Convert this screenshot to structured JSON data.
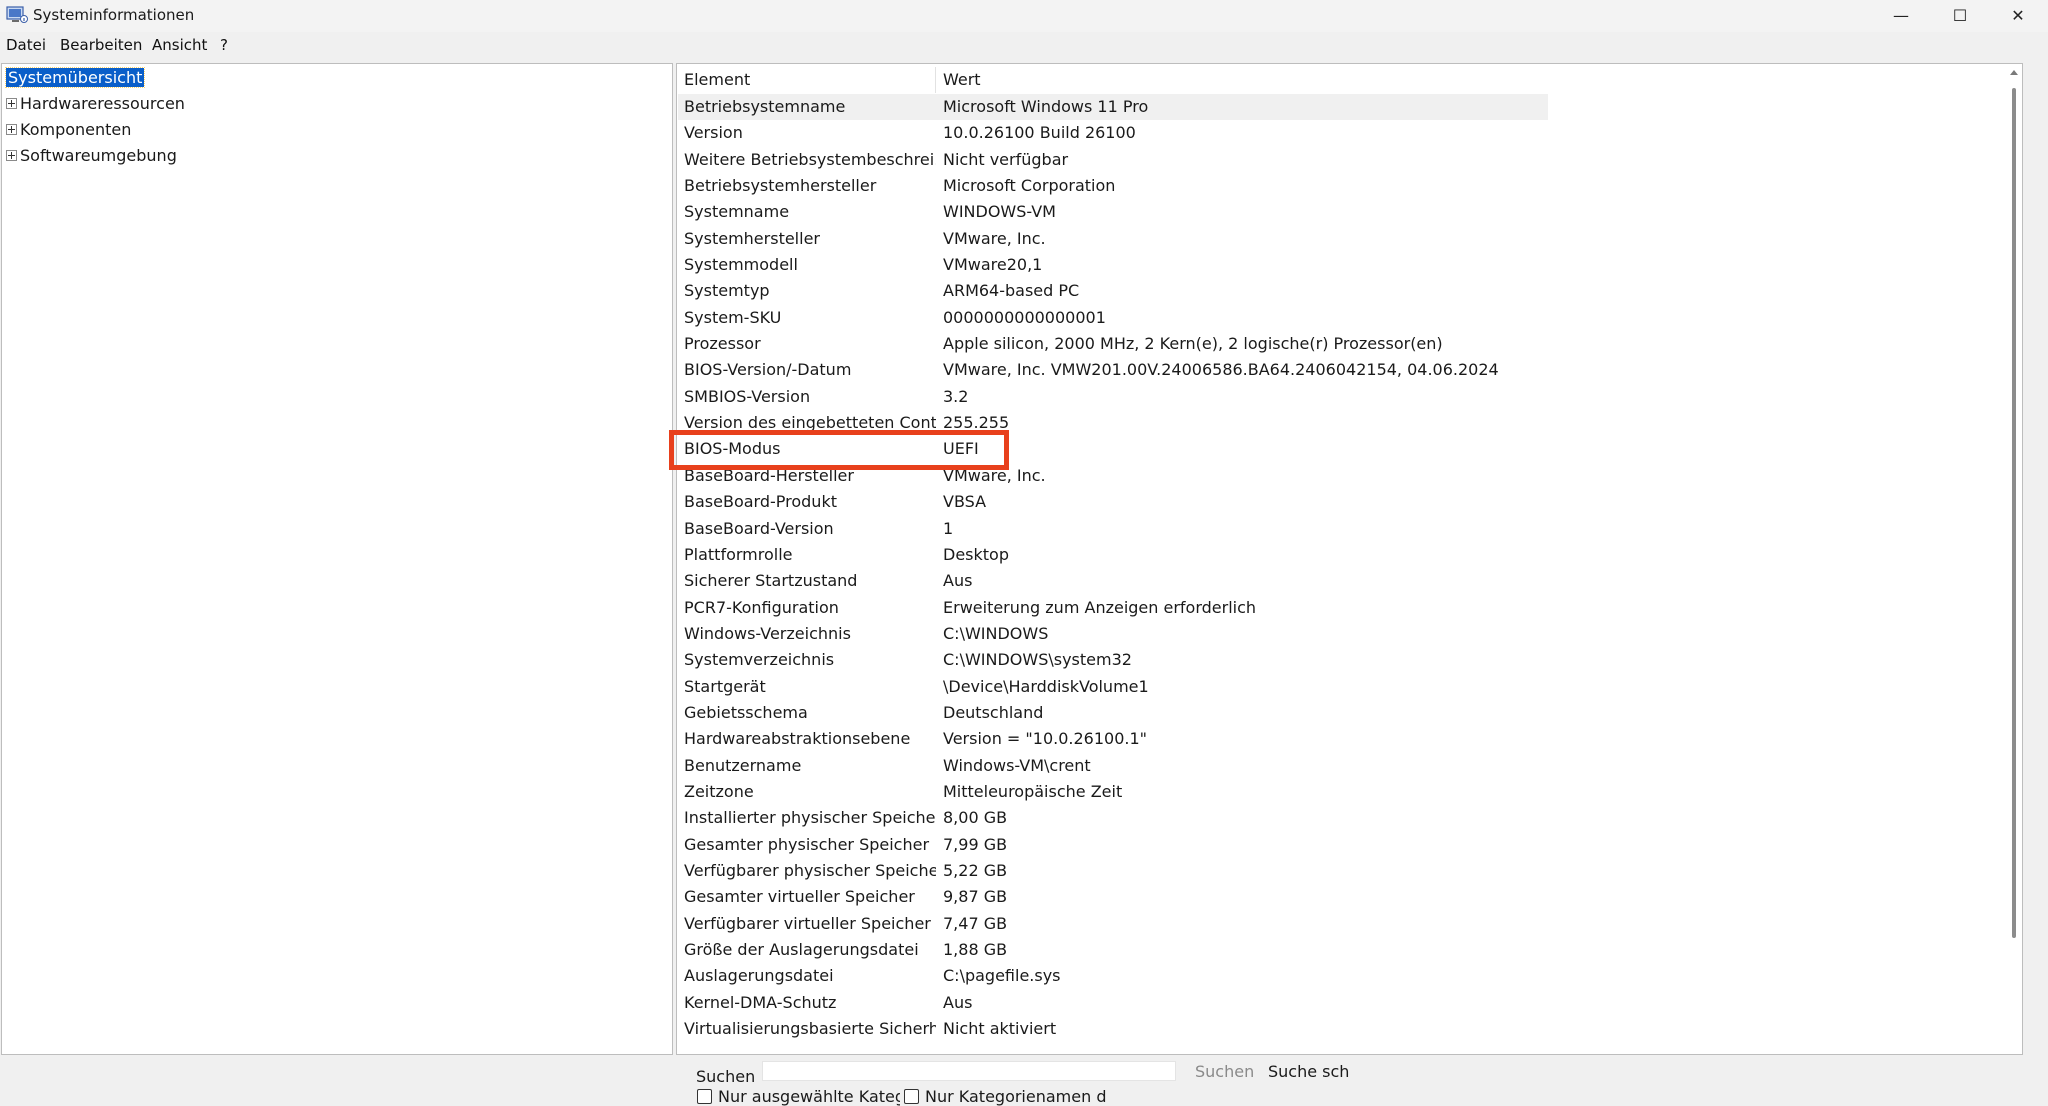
{
  "window": {
    "title": "Systeminformationen",
    "minimize_glyph": "—",
    "maximize_glyph": "☐",
    "close_glyph": "✕"
  },
  "menu": [
    "Datei",
    "Bearbeiten",
    "Ansicht",
    "?"
  ],
  "tree": {
    "items": [
      {
        "label": "Systemübersicht",
        "selected": true,
        "expandable": false
      },
      {
        "label": "Hardwareressourcen",
        "selected": false,
        "expandable": true
      },
      {
        "label": "Komponenten",
        "selected": false,
        "expandable": true
      },
      {
        "label": "Softwareumgebung",
        "selected": false,
        "expandable": true
      }
    ]
  },
  "list": {
    "columns": [
      "Element",
      "Wert"
    ],
    "rows": [
      [
        "Betriebsystemname",
        "Microsoft Windows 11 Pro"
      ],
      [
        "Version",
        "10.0.26100 Build 26100"
      ],
      [
        "Weitere Betriebsystembeschrei...",
        "Nicht verfügbar"
      ],
      [
        "Betriebsystemhersteller",
        "Microsoft Corporation"
      ],
      [
        "Systemname",
        "WINDOWS-VM"
      ],
      [
        "Systemhersteller",
        "VMware, Inc."
      ],
      [
        "Systemmodell",
        "VMware20,1"
      ],
      [
        "Systemtyp",
        "ARM64-based PC"
      ],
      [
        "System-SKU",
        "0000000000000001"
      ],
      [
        "Prozessor",
        "Apple silicon, 2000 MHz, 2 Kern(e), 2 logische(r) Prozessor(en)"
      ],
      [
        "BIOS-Version/-Datum",
        "VMware, Inc. VMW201.00V.24006586.BA64.2406042154, 04.06.2024"
      ],
      [
        "SMBIOS-Version",
        "3.2"
      ],
      [
        "Version des eingebetteten Cont...",
        "255.255"
      ],
      [
        "BIOS-Modus",
        "UEFI"
      ],
      [
        "BaseBoard-Hersteller",
        "VMware, Inc."
      ],
      [
        "BaseBoard-Produkt",
        "VBSA"
      ],
      [
        "BaseBoard-Version",
        "1"
      ],
      [
        "Plattformrolle",
        "Desktop"
      ],
      [
        "Sicherer Startzustand",
        "Aus"
      ],
      [
        "PCR7-Konfiguration",
        "Erweiterung zum Anzeigen erforderlich"
      ],
      [
        "Windows-Verzeichnis",
        "C:\\WINDOWS"
      ],
      [
        "Systemverzeichnis",
        "C:\\WINDOWS\\system32"
      ],
      [
        "Startgerät",
        "\\Device\\HarddiskVolume1"
      ],
      [
        "Gebietsschema",
        "Deutschland"
      ],
      [
        "Hardwareabstraktionsebene",
        "Version = \"10.0.26100.1\""
      ],
      [
        "Benutzername",
        "Windows-VM\\crent"
      ],
      [
        "Zeitzone",
        "Mitteleuropäische Zeit"
      ],
      [
        "Installierter physischer Speicher...",
        "8,00 GB"
      ],
      [
        "Gesamter physischer Speicher",
        "7,99 GB"
      ],
      [
        "Verfügbarer physischer Speicher",
        "5,22 GB"
      ],
      [
        "Gesamter virtueller Speicher",
        "9,87 GB"
      ],
      [
        "Verfügbarer virtueller Speicher",
        "7,47 GB"
      ],
      [
        "Größe der Auslagerungsdatei",
        "1,88 GB"
      ],
      [
        "Auslagerungsdatei",
        "C:\\pagefile.sys"
      ],
      [
        "Kernel-DMA-Schutz",
        "Aus"
      ],
      [
        "Virtualisierungsbasierte Sicherh...",
        "Nicht aktiviert"
      ]
    ]
  },
  "search": {
    "label": "Suchen",
    "value": "",
    "button": "Suchen",
    "close_button": "Suche schließen",
    "checkbox_selected_only": "Nur ausgewählte Kategorie",
    "checkbox_names_only": "Nur Kategorienamen durchsuchen"
  },
  "colors": {
    "selection": "#0a5ec9",
    "highlight_annotation": "#e8401c"
  }
}
